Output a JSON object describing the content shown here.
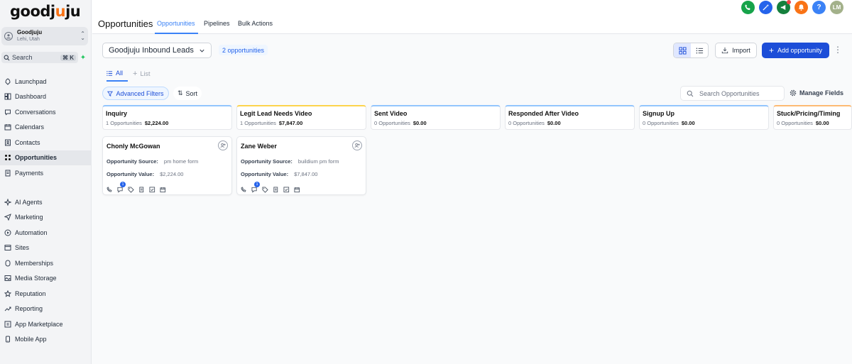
{
  "brand": {
    "logo_prefix": "goodj",
    "logo_o": "u",
    "logo_suffix": "ju"
  },
  "location": {
    "name": "Goodjuju",
    "subtitle": "Lehi, Utah"
  },
  "sidebar_search": {
    "label": "Search",
    "shortcut": "⌘ K"
  },
  "nav_primary": [
    {
      "label": "Launchpad",
      "icon": "rocket-icon"
    },
    {
      "label": "Dashboard",
      "icon": "dashboard-icon"
    },
    {
      "label": "Conversations",
      "icon": "chat-icon"
    },
    {
      "label": "Calendars",
      "icon": "calendar-icon"
    },
    {
      "label": "Contacts",
      "icon": "contacts-icon"
    },
    {
      "label": "Opportunities",
      "icon": "opportunities-icon",
      "active": true
    },
    {
      "label": "Payments",
      "icon": "payments-icon"
    }
  ],
  "nav_secondary": [
    {
      "label": "AI Agents",
      "icon": "sparkle-icon"
    },
    {
      "label": "Marketing",
      "icon": "send-icon"
    },
    {
      "label": "Automation",
      "icon": "automation-icon"
    },
    {
      "label": "Sites",
      "icon": "sites-icon"
    },
    {
      "label": "Memberships",
      "icon": "memberships-icon"
    },
    {
      "label": "Media Storage",
      "icon": "media-icon"
    },
    {
      "label": "Reputation",
      "icon": "star-icon"
    },
    {
      "label": "Reporting",
      "icon": "reporting-icon"
    },
    {
      "label": "App Marketplace",
      "icon": "marketplace-icon"
    },
    {
      "label": "Mobile App",
      "icon": "mobile-icon"
    }
  ],
  "header": {
    "title": "Opportunities",
    "tabs": [
      "Opportunities",
      "Pipelines",
      "Bulk Actions"
    ],
    "active_tab": "Opportunities",
    "avatar_initials": "LM",
    "help_symbol": "?"
  },
  "top_icon_colors": [
    "#16a34a",
    "#2563eb",
    "#15803d",
    "#f97316",
    "#3b82f6",
    "#a3b18a"
  ],
  "toolbar": {
    "pipeline": "Goodjuju Inbound Leads",
    "count_label": "2 opportunities",
    "import_label": "Import",
    "add_label": "Add opportunity",
    "kebab": "⋮"
  },
  "view_tabs": {
    "all": "All",
    "list": "List"
  },
  "filters": {
    "advanced_label": "Advanced Filters",
    "sort_label": "Sort",
    "search_placeholder": "Search Opportunities",
    "manage_fields_label": "Manage Fields"
  },
  "stages": [
    {
      "name": "Inquiry",
      "count": "1 Opportunities",
      "value": "$2,224.00",
      "accent": "#93c5fd"
    },
    {
      "name": "Legit Lead Needs Video",
      "count": "1 Opportunities",
      "value": "$7,847.00",
      "accent": "#fcd34d"
    },
    {
      "name": "Sent Video",
      "count": "0 Opportunities",
      "value": "$0.00",
      "accent": "#93c5fd"
    },
    {
      "name": "Responded After Video",
      "count": "0 Opportunities",
      "value": "$0.00",
      "accent": "#93c5fd"
    },
    {
      "name": "Signup Up",
      "count": "0 Opportunities",
      "value": "$0.00",
      "accent": "#93c5fd"
    },
    {
      "name": "Stuck/Pricing/Timing",
      "count": "0 Opportunities",
      "value": "$0.00",
      "accent": "#fdba74"
    }
  ],
  "cards": [
    {
      "name": "Chonly McGowan",
      "source_label": "Opportunity Source:",
      "source": "pm home form",
      "value_label": "Opportunity Value:",
      "value": "$2,224.00",
      "badge": "1"
    },
    {
      "name": "Zane Weber",
      "source_label": "Opportunity Source:",
      "source": "buildium pm form",
      "value_label": "Opportunity Value:",
      "value": "$7,847.00",
      "badge": "1"
    }
  ]
}
